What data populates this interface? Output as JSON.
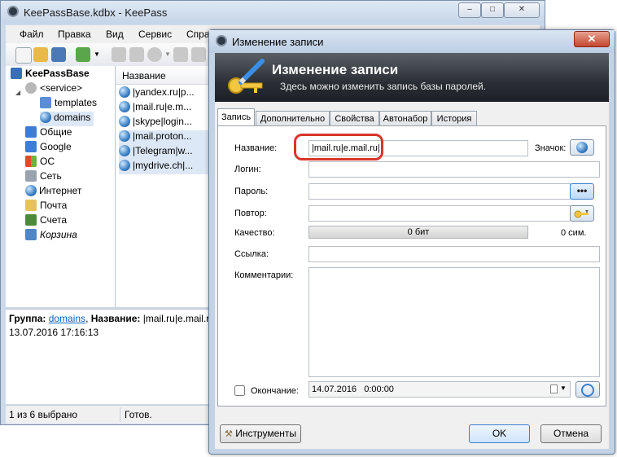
{
  "main": {
    "title": "KeePassBase.kdbx - KeePass",
    "menu": [
      "Файл",
      "Правка",
      "Вид",
      "Сервис",
      "Спра"
    ],
    "tree": [
      {
        "label": "KeePassBase",
        "level": 0,
        "bold": true
      },
      {
        "label": "<service>",
        "level": 1
      },
      {
        "label": "templates",
        "level": 2
      },
      {
        "label": "domains",
        "level": 2,
        "selected": true
      },
      {
        "label": "Общие",
        "level": 1
      },
      {
        "label": "Google",
        "level": 1
      },
      {
        "label": "ОС",
        "level": 1
      },
      {
        "label": "Сеть",
        "level": 1
      },
      {
        "label": "Интернет",
        "level": 1
      },
      {
        "label": "Почта",
        "level": 1
      },
      {
        "label": "Счета",
        "level": 1
      },
      {
        "label": "Корзина",
        "level": 1,
        "italic": true
      }
    ],
    "entries_header": "Название",
    "entries": [
      "|yandex.ru|p...",
      "|mail.ru|e.m...",
      "|skype|login...",
      "|mail.proton...",
      "|Telegram|w...",
      "|mydrive.ch|..."
    ],
    "info": {
      "group_label": "Группа:",
      "group_link": "domains",
      "name_label": "Название:",
      "name_value": "|mail.ru|e.mail.ru",
      "date": "13.07.2016 17:16:13"
    },
    "status": {
      "selection": "1 из 6 выбрано",
      "state": "Готов."
    }
  },
  "dialog": {
    "title": "Изменение записи",
    "banner_title": "Изменение записи",
    "banner_subtitle": "Здесь можно изменить запись базы паролей.",
    "tabs": [
      "Запись",
      "Дополнительно",
      "Свойства",
      "Автонабор",
      "История"
    ],
    "fields": {
      "name_label": "Название:",
      "name_value": "|mail.ru|e.mail.ru|",
      "icon_label": "Значок:",
      "login_label": "Логин:",
      "login_value": "",
      "password_label": "Пароль:",
      "password_value": "",
      "repeat_label": "Повтор:",
      "repeat_value": "",
      "quality_label": "Качество:",
      "quality_bar_text": "0 бит",
      "quality_chars": "0 сим.",
      "url_label": "Ссылка:",
      "url_value": "",
      "notes_label": "Комментарии:",
      "notes_value": "",
      "expires_label": "Окончание:",
      "expires_value": "14.07.2016   0:00:00",
      "expires_checked": false,
      "password_dots": "•••"
    },
    "buttons": {
      "tools": "Инструменты",
      "ok": "OK",
      "cancel": "Отмена"
    },
    "highlight_color": "#d9362b"
  }
}
